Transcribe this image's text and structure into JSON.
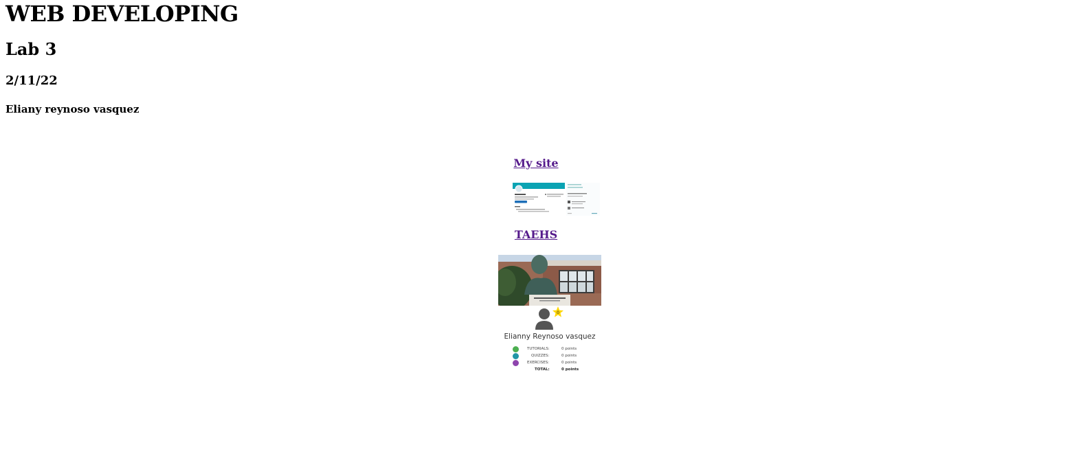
{
  "header": {
    "title": "WEB DEVELOPING",
    "subtitle": "Lab 3",
    "date": "2/11/22",
    "author": "Eliany reynoso vasquez"
  },
  "links": [
    {
      "label": "My site"
    },
    {
      "label": "TAEHS"
    }
  ],
  "profile": {
    "name": "Elianny Reynoso vasquez",
    "stats": [
      {
        "label": "TUTORIALS:",
        "value": "0 points",
        "color": "#4caf50"
      },
      {
        "label": "QUIZZES:",
        "value": "0 points",
        "color": "#2196a6"
      },
      {
        "label": "EXERCISES:",
        "value": "0 points",
        "color": "#8e44ad"
      }
    ],
    "total_label": "TOTAL:",
    "total_value": "0 points",
    "icons": [
      "user-avatar-icon",
      "star-badge-icon"
    ]
  },
  "colors": {
    "link_visited": "#551a8b",
    "site_header_teal": "#0aa3b3",
    "star_yellow": "#ffd600"
  }
}
